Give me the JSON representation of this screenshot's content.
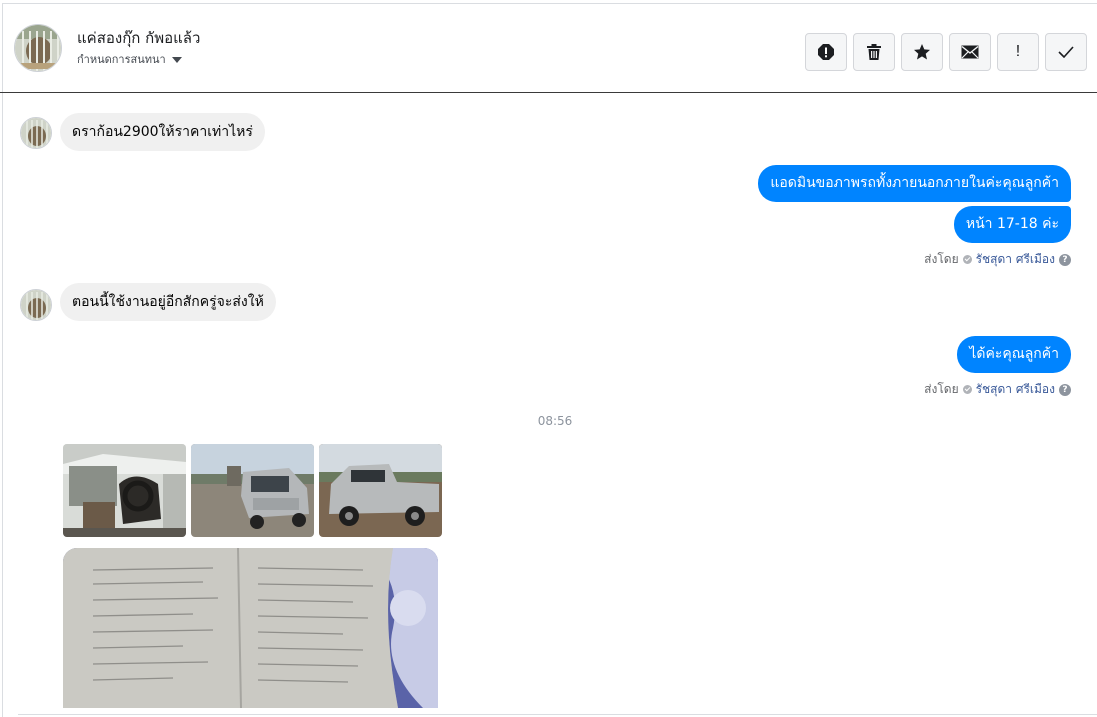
{
  "header": {
    "contact_name": "แค่สองกุ๊ก กัพอแล้ว",
    "conversation_settings": "กำหนดการสนทนา",
    "actions": [
      {
        "icon": "alert-circle-icon",
        "label": ""
      },
      {
        "icon": "trash-icon",
        "label": ""
      },
      {
        "icon": "star-icon",
        "label": ""
      },
      {
        "icon": "envelope-icon",
        "label": ""
      },
      {
        "icon": "exclamation-icon",
        "label": "!"
      },
      {
        "icon": "check-icon",
        "label": ""
      }
    ]
  },
  "messages": {
    "m1": "ดราก้อน2900ให้ราคาเท่าไหร่",
    "m2": "แอดมินขอภาพรถทั้งภายนอกภายในค่ะคุณลูกค้า",
    "m3": "หน้า 17-18 ค่ะ",
    "m4": "ตอนนี้ใช้งานอยู่อีกสักครู่จะส่งให้",
    "m5": "ได้ค่ะคุณลูกค้า"
  },
  "sent_by": {
    "prefix": "ส่งโดย",
    "agent": "รัชสุดา ศรีเมือง",
    "help": "?"
  },
  "timestamp": "08:56",
  "attachments": [
    {
      "icon": "car-interior-photo"
    },
    {
      "icon": "car-front-photo"
    },
    {
      "icon": "car-side-photo"
    },
    {
      "icon": "document-photo"
    }
  ],
  "colors": {
    "outgoing_bubble": "#0084ff",
    "incoming_bubble": "#f0f0f0",
    "agent_link": "#385898",
    "meta_text": "#65676b"
  }
}
